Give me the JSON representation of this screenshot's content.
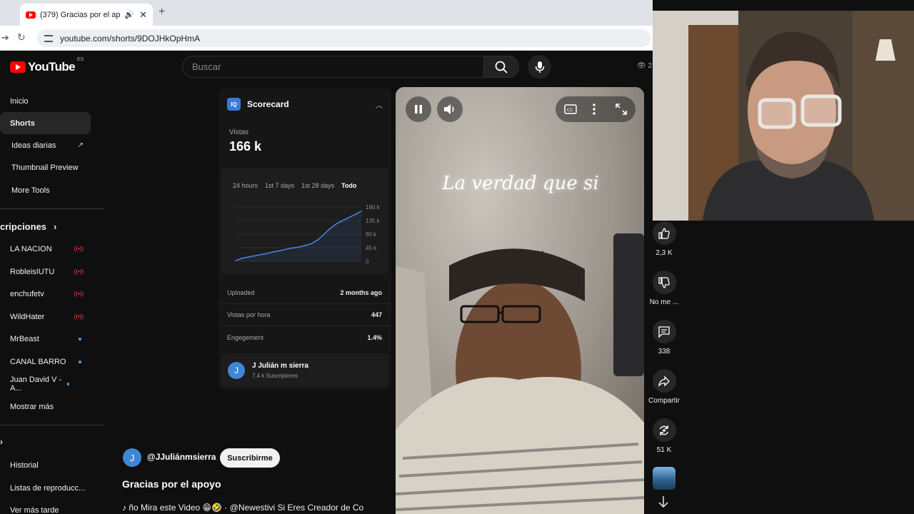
{
  "browser": {
    "tab_title": "(379) Gracias por el apoyo",
    "tab_audio_icon": "speaker-icon",
    "url": "youtube.com/shorts/9DOJHkOpHmA"
  },
  "header": {
    "logo_text": "YouTube",
    "country_code": "ES",
    "search_placeholder": "Buscar",
    "views_partial": "2,"
  },
  "sidebar": {
    "main": [
      {
        "label": "Inicio"
      },
      {
        "label": "Shorts",
        "active": true
      },
      {
        "label": "Ideas diarias",
        "icon": "external-link-icon"
      },
      {
        "label": "Thumbnail Preview"
      },
      {
        "label": "More Tools"
      }
    ],
    "subs_heading": "cripciones",
    "subscriptions": [
      {
        "label": "LA NACION",
        "status": "live"
      },
      {
        "label": "RobleisIUTU",
        "status": "live"
      },
      {
        "label": "enchufetv",
        "status": "live"
      },
      {
        "label": "WildHater",
        "status": "live"
      },
      {
        "label": "MrBeast",
        "status": "new"
      },
      {
        "label": "CANAL BARRO",
        "status": "new"
      },
      {
        "label": "Juan David V - A...",
        "status": "new"
      },
      {
        "label": "Mostrar más"
      }
    ],
    "you": [
      {
        "label": "Historial"
      },
      {
        "label": "Listas de reproducc..."
      },
      {
        "label": "Ver más tarde"
      }
    ]
  },
  "scorecard": {
    "logo": "IQ",
    "title": "Scorecard",
    "views_label": "Vistas",
    "views_value": "166 k",
    "ranges": [
      "24 hours",
      "1st 7 days",
      "1st 28 days",
      "Todo"
    ],
    "active_range": "Todo",
    "y_ticks": [
      "180 k",
      "135 k",
      "90 k",
      "45 k",
      "0"
    ],
    "stats": [
      {
        "label": "Uploaded",
        "value": "2 months ago"
      },
      {
        "label": "Vistas por hora",
        "value": "447"
      },
      {
        "label": "Engegement",
        "value": "1.4%"
      }
    ],
    "channel_initial": "J",
    "channel_name": "J Julián m sierra",
    "channel_subs": "7.4 k Suscriptores"
  },
  "chart_data": {
    "type": "line",
    "title": "",
    "xlabel": "",
    "ylabel": "",
    "ylim": [
      0,
      180000
    ],
    "yticks": [
      "180 k",
      "135 k",
      "90 k",
      "45 k",
      "0"
    ],
    "x": [
      0,
      1,
      2,
      3,
      4,
      5,
      6,
      7,
      8,
      9,
      10,
      11,
      12,
      13,
      14,
      15,
      16,
      17,
      18,
      19,
      20
    ],
    "values": [
      2000,
      10000,
      14000,
      18000,
      22000,
      26000,
      31000,
      35000,
      40000,
      44000,
      47000,
      52000,
      58000,
      70000,
      88000,
      108000,
      124000,
      135000,
      145000,
      155000,
      166000
    ],
    "grid": true,
    "color": "#4a7fd9"
  },
  "video": {
    "caption": "La verdad que si"
  },
  "overlay": {
    "channel_initial": "J",
    "channel_handle": "@JJuliánmsierra",
    "subscribe_label": "Suscribirme",
    "title": "Gracias por el apoyo",
    "music_text": "ño Mira este Video 😁🤣 · @Newestivi    Si Eres Creador de Co"
  },
  "actions": {
    "likes": "2,3 K",
    "dislike_label": "No me ...",
    "comments": "338",
    "share_label": "Compartir",
    "remix": "51 K"
  },
  "colors": {
    "accent_blue": "#3ea6ff",
    "youtube_red": "#ff0000",
    "live_red": "#ff4e45"
  }
}
